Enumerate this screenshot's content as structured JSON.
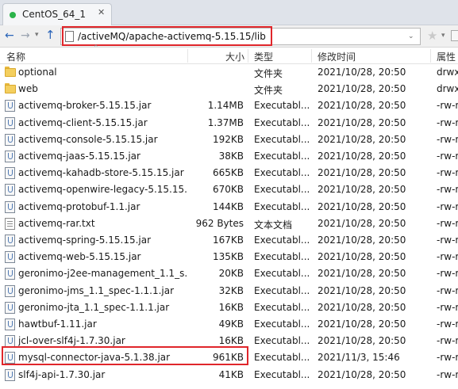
{
  "tab": {
    "title": "CentOS_64_1",
    "close": "✕"
  },
  "toolbar": {
    "path": "/activeMQ/apache-activemq-5.15.15/lib",
    "back_icon": "arrow-left-icon",
    "forward_icon": "arrow-right-icon",
    "up_icon": "arrow-up-icon",
    "bookmark_icon": "star-icon"
  },
  "columns": {
    "name": "名称",
    "size": "大小",
    "type": "类型",
    "modified": "修改时间",
    "perm": "属性"
  },
  "colors": {
    "highlight": "#e0262b",
    "folder": "#f4cf5e"
  },
  "files": [
    {
      "name": "optional",
      "size": "",
      "type": "文件夹",
      "date": "2021/10/28, 20:50",
      "perm": "drwx",
      "icon": "folder"
    },
    {
      "name": "web",
      "size": "",
      "type": "文件夹",
      "date": "2021/10/28, 20:50",
      "perm": "drwx",
      "icon": "folder"
    },
    {
      "name": "activemq-broker-5.15.15.jar",
      "size": "1.14MB",
      "type": "Executabl...",
      "date": "2021/10/28, 20:50",
      "perm": "-rw-r",
      "icon": "jar"
    },
    {
      "name": "activemq-client-5.15.15.jar",
      "size": "1.37MB",
      "type": "Executabl...",
      "date": "2021/10/28, 20:50",
      "perm": "-rw-r",
      "icon": "jar"
    },
    {
      "name": "activemq-console-5.15.15.jar",
      "size": "192KB",
      "type": "Executabl...",
      "date": "2021/10/28, 20:50",
      "perm": "-rw-r",
      "icon": "jar"
    },
    {
      "name": "activemq-jaas-5.15.15.jar",
      "size": "38KB",
      "type": "Executabl...",
      "date": "2021/10/28, 20:50",
      "perm": "-rw-r",
      "icon": "jar"
    },
    {
      "name": "activemq-kahadb-store-5.15.15.jar",
      "size": "665KB",
      "type": "Executabl...",
      "date": "2021/10/28, 20:50",
      "perm": "-rw-r",
      "icon": "jar"
    },
    {
      "name": "activemq-openwire-legacy-5.15.15....",
      "size": "670KB",
      "type": "Executabl...",
      "date": "2021/10/28, 20:50",
      "perm": "-rw-r",
      "icon": "jar"
    },
    {
      "name": "activemq-protobuf-1.1.jar",
      "size": "144KB",
      "type": "Executabl...",
      "date": "2021/10/28, 20:50",
      "perm": "-rw-r",
      "icon": "jar"
    },
    {
      "name": "activemq-rar.txt",
      "size": "962 Bytes",
      "type": "文本文档",
      "date": "2021/10/28, 20:50",
      "perm": "-rw-r",
      "icon": "txt"
    },
    {
      "name": "activemq-spring-5.15.15.jar",
      "size": "167KB",
      "type": "Executabl...",
      "date": "2021/10/28, 20:50",
      "perm": "-rw-r",
      "icon": "jar"
    },
    {
      "name": "activemq-web-5.15.15.jar",
      "size": "135KB",
      "type": "Executabl...",
      "date": "2021/10/28, 20:50",
      "perm": "-rw-r",
      "icon": "jar"
    },
    {
      "name": "geronimo-j2ee-management_1.1_s...",
      "size": "20KB",
      "type": "Executabl...",
      "date": "2021/10/28, 20:50",
      "perm": "-rw-r",
      "icon": "jar"
    },
    {
      "name": "geronimo-jms_1.1_spec-1.1.1.jar",
      "size": "32KB",
      "type": "Executabl...",
      "date": "2021/10/28, 20:50",
      "perm": "-rw-r",
      "icon": "jar"
    },
    {
      "name": "geronimo-jta_1.1_spec-1.1.1.jar",
      "size": "16KB",
      "type": "Executabl...",
      "date": "2021/10/28, 20:50",
      "perm": "-rw-r",
      "icon": "jar"
    },
    {
      "name": "hawtbuf-1.11.jar",
      "size": "49KB",
      "type": "Executabl...",
      "date": "2021/10/28, 20:50",
      "perm": "-rw-r",
      "icon": "jar"
    },
    {
      "name": "jcl-over-slf4j-1.7.30.jar",
      "size": "16KB",
      "type": "Executabl...",
      "date": "2021/10/28, 20:50",
      "perm": "-rw-r",
      "icon": "jar"
    },
    {
      "name": "mysql-connector-java-5.1.38.jar",
      "size": "961KB",
      "type": "Executabl...",
      "date": "2021/11/3, 15:46",
      "perm": "-rw-r",
      "icon": "jar"
    },
    {
      "name": "slf4j-api-1.7.30.jar",
      "size": "41KB",
      "type": "Executabl...",
      "date": "2021/10/28, 20:50",
      "perm": "-rw-r",
      "icon": "jar"
    }
  ]
}
